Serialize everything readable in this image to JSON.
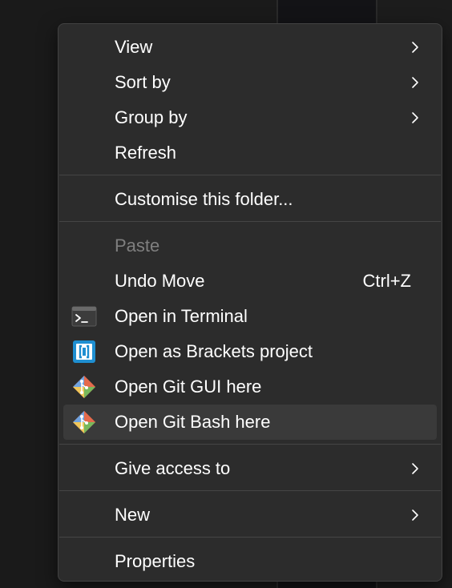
{
  "menu": {
    "items": {
      "view": {
        "label": "View",
        "icon": "",
        "submenu": true
      },
      "sort_by": {
        "label": "Sort by",
        "submenu": true
      },
      "group_by": {
        "label": "Group by",
        "submenu": true
      },
      "refresh": {
        "label": "Refresh"
      },
      "customise": {
        "label": "Customise this folder..."
      },
      "paste": {
        "label": "Paste",
        "disabled": true
      },
      "undo_move": {
        "label": "Undo Move",
        "shortcut": "Ctrl+Z"
      },
      "open_terminal": {
        "label": "Open in Terminal",
        "icon": "terminal-icon"
      },
      "open_brackets": {
        "label": "Open as Brackets project",
        "icon": "brackets-icon"
      },
      "open_git_gui": {
        "label": "Open Git GUI here",
        "icon": "git-gui-icon"
      },
      "open_git_bash": {
        "label": "Open Git Bash here",
        "icon": "git-bash-icon",
        "highlighted": true
      },
      "give_access": {
        "label": "Give access to",
        "submenu": true
      },
      "new": {
        "label": "New",
        "submenu": true
      },
      "properties": {
        "label": "Properties"
      }
    }
  },
  "colors": {
    "menu_bg": "#2c2c2c",
    "highlight_bg": "#3a3a3a",
    "text": "#ffffff",
    "disabled_text": "#7f7f7f",
    "separator": "#454545",
    "brackets_blue": "#1f8fd1"
  }
}
